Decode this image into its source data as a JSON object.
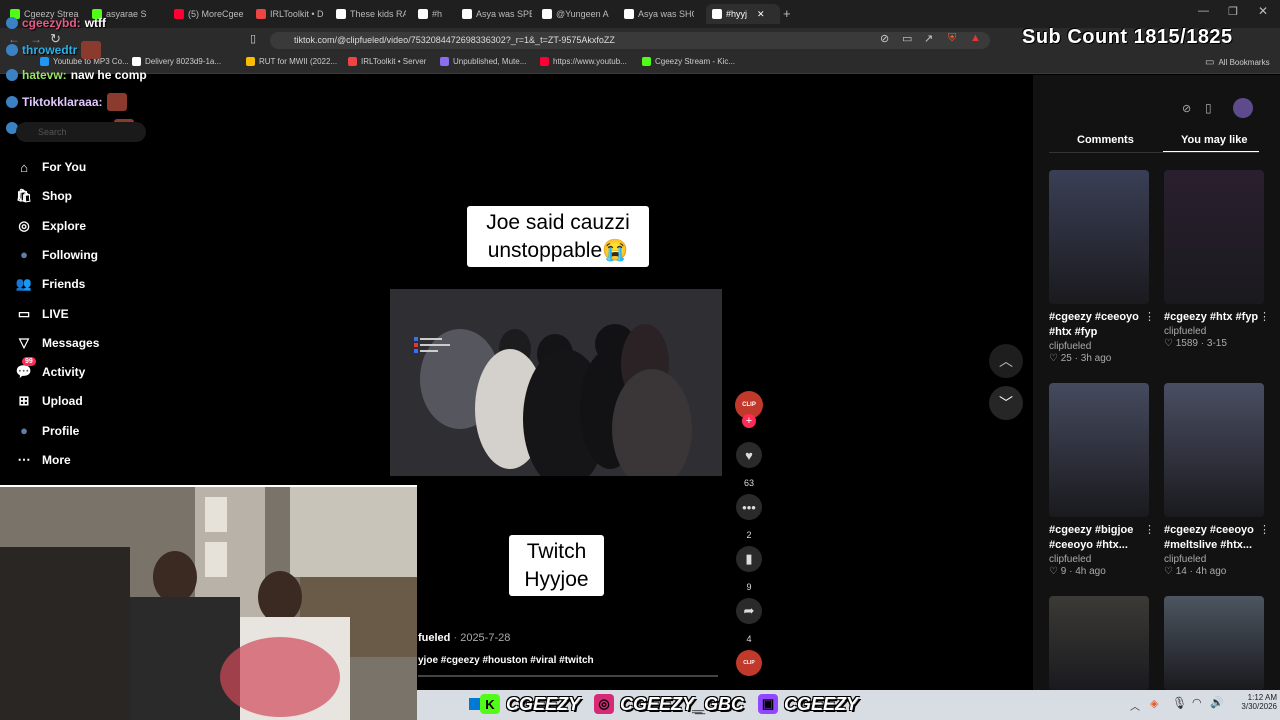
{
  "browser": {
    "tabs": [
      {
        "label": "Cgeezy Strea",
        "color": "#53fc18"
      },
      {
        "label": "asyarae S",
        "color": "#53fc18"
      },
      {
        "label": "(5) MoreCgee",
        "color": "#ff0033"
      },
      {
        "label": "IRLToolkit • D",
        "color": "#e44"
      },
      {
        "label": "These kids RA",
        "color": "#ffffff"
      },
      {
        "label": "#h",
        "color": "#ffffff"
      },
      {
        "label": "Asya was SPE",
        "color": "#ffffff"
      },
      {
        "label": "@Yungeen A",
        "color": "#ffffff"
      },
      {
        "label": "Asya was SHO",
        "color": "#ffffff"
      },
      {
        "label": "#hyyj",
        "color": "#ffffff"
      }
    ],
    "url": "tiktok.com/@clipfueled/video/7532084472698336302?_r=1&_t=ZT-9575AkxfoZZ",
    "bookmarks": [
      {
        "label": "Youtube to MP3 Co...",
        "color": "#2196f3"
      },
      {
        "label": "Delivery 8023d9-1a...",
        "color": "#ffffff"
      },
      {
        "label": "RUT for MWII (2022...",
        "color": "#fbbc04"
      },
      {
        "label": "IRLToolkit • Server",
        "color": "#e44"
      },
      {
        "label": "Unpublished, Mute...",
        "color": "#8e6cf0"
      },
      {
        "label": "https://www.youtub...",
        "color": "#ff0033"
      },
      {
        "label": "Cgeezy Stream - Kic...",
        "color": "#53fc18"
      }
    ],
    "all_bookmarks": "All Bookmarks"
  },
  "overlay": {
    "sub_count": "Sub Count 1815/1825",
    "chat": [
      {
        "user": "cgeezybd:",
        "message": "wtff",
        "color": "#e85a8a"
      },
      {
        "user": "throwedtr",
        "message": "",
        "color": "#2ab0e8"
      },
      {
        "user": "hatevw:",
        "message": "naw he comp",
        "color": "#9be36b"
      },
      {
        "user": "Tiktokklaraaa:",
        "message": "",
        "color": "#e0c8ff"
      },
      {
        "user": "Therealkiaraaa:",
        "message": "",
        "color": "#e0c8ff"
      }
    ],
    "socials": [
      {
        "handle": "CGEEZY",
        "icon": "kick-icon",
        "color": "#53fc18",
        "glyph": "K"
      },
      {
        "handle": "CGEEZY_GBC",
        "icon": "instagram-icon",
        "color": "#d62976",
        "glyph": "◎"
      },
      {
        "handle": "CGEEZY",
        "icon": "twitch-icon",
        "color": "#9146ff",
        "glyph": "▣"
      }
    ]
  },
  "sidebar": {
    "items": [
      {
        "label": "For You",
        "icon": "home-icon",
        "glyph": "⌂"
      },
      {
        "label": "Shop",
        "icon": "shop-icon",
        "glyph": "🛍"
      },
      {
        "label": "Explore",
        "icon": "compass-icon",
        "glyph": "◎"
      },
      {
        "label": "Following",
        "icon": "following-avatar-icon",
        "glyph": "●"
      },
      {
        "label": "Friends",
        "icon": "friends-icon",
        "glyph": "👥"
      },
      {
        "label": "LIVE",
        "icon": "live-icon",
        "glyph": "▭"
      },
      {
        "label": "Messages",
        "icon": "messages-icon",
        "glyph": "▽"
      },
      {
        "label": "Activity",
        "icon": "activity-icon",
        "glyph": "💬",
        "badge": "99"
      },
      {
        "label": "Upload",
        "icon": "upload-icon",
        "glyph": "⊞"
      },
      {
        "label": "Profile",
        "icon": "profile-avatar-icon",
        "glyph": "●"
      },
      {
        "label": "More",
        "icon": "more-icon",
        "glyph": "⋯"
      }
    ]
  },
  "video": {
    "caption_top": "Joe said cauzzi unstoppable😭",
    "caption_bottom": "Twitch Hyyjoe",
    "author": "fueled",
    "date": "2025-7-28",
    "hashtags": "yjoe #cgeezy #houston #viral #twitch",
    "likes": "63",
    "comments": "2",
    "saves": "9",
    "shares": "4"
  },
  "right_panel": {
    "tabs": [
      "Comments",
      "You may like"
    ],
    "active_tab": "You may like",
    "cards": [
      {
        "title": "#cgeezy #ceeoyo #htx #fyp",
        "author": "clipfueled",
        "likes": "25",
        "time": "3h ago",
        "thumb": "#3a3f55"
      },
      {
        "title": "#cgeezy #htx #fyp",
        "author": "clipfueled",
        "likes": "1589",
        "time": "3-15",
        "thumb": "#2a1f2e"
      },
      {
        "title": "#cgeezy #bigjoe #ceeoyo #htx...",
        "author": "clipfueled",
        "likes": "9",
        "time": "4h ago",
        "thumb": "#454a5e"
      },
      {
        "title": "#cgeezy #ceeoyo #meltslive #htx...",
        "author": "clipfueled",
        "likes": "14",
        "time": "4h ago",
        "thumb": "#4a4e62"
      },
      {
        "title": "",
        "author": "",
        "likes": "",
        "time": "",
        "thumb": "#3c3a36"
      },
      {
        "title": "",
        "author": "",
        "likes": "",
        "time": "",
        "thumb": "#4c5560"
      }
    ]
  },
  "taskbar": {
    "time": "1:12 AM",
    "date": "3/30/2026"
  }
}
